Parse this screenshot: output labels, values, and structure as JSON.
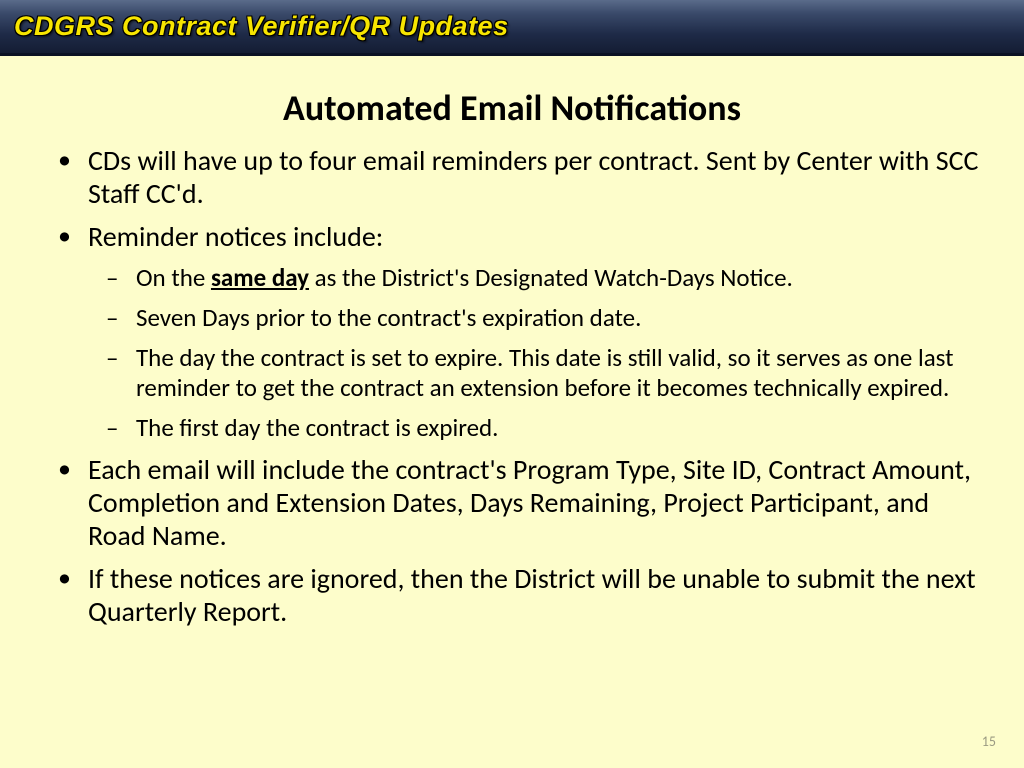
{
  "header": {
    "title": "CDGRS Contract Verifier/QR Updates"
  },
  "slide": {
    "title": "Automated Email Notifications",
    "bullets": {
      "b1": "CDs will have up to four email reminders per contract. Sent by Center with SCC Staff CC'd.",
      "b2": "Reminder notices include:",
      "b2_sub": {
        "s1_pre": "On the ",
        "s1_emph": "same day",
        "s1_post": " as the District's Designated Watch-Days Notice.",
        "s2": "Seven Days prior to the contract's expiration date.",
        "s3": "The day the contract is set to expire. This date is still valid, so it serves as one last reminder to get the contract an extension before it becomes technically expired.",
        "s4": "The first day the contract is expired."
      },
      "b3": "Each email will include the contract's Program Type, Site ID, Contract Amount, Completion and Extension Dates, Days Remaining, Project Participant, and Road Name.",
      "b4": "If these notices are ignored, then the District will be unable to submit the next Quarterly Report."
    },
    "page_number": "15"
  }
}
